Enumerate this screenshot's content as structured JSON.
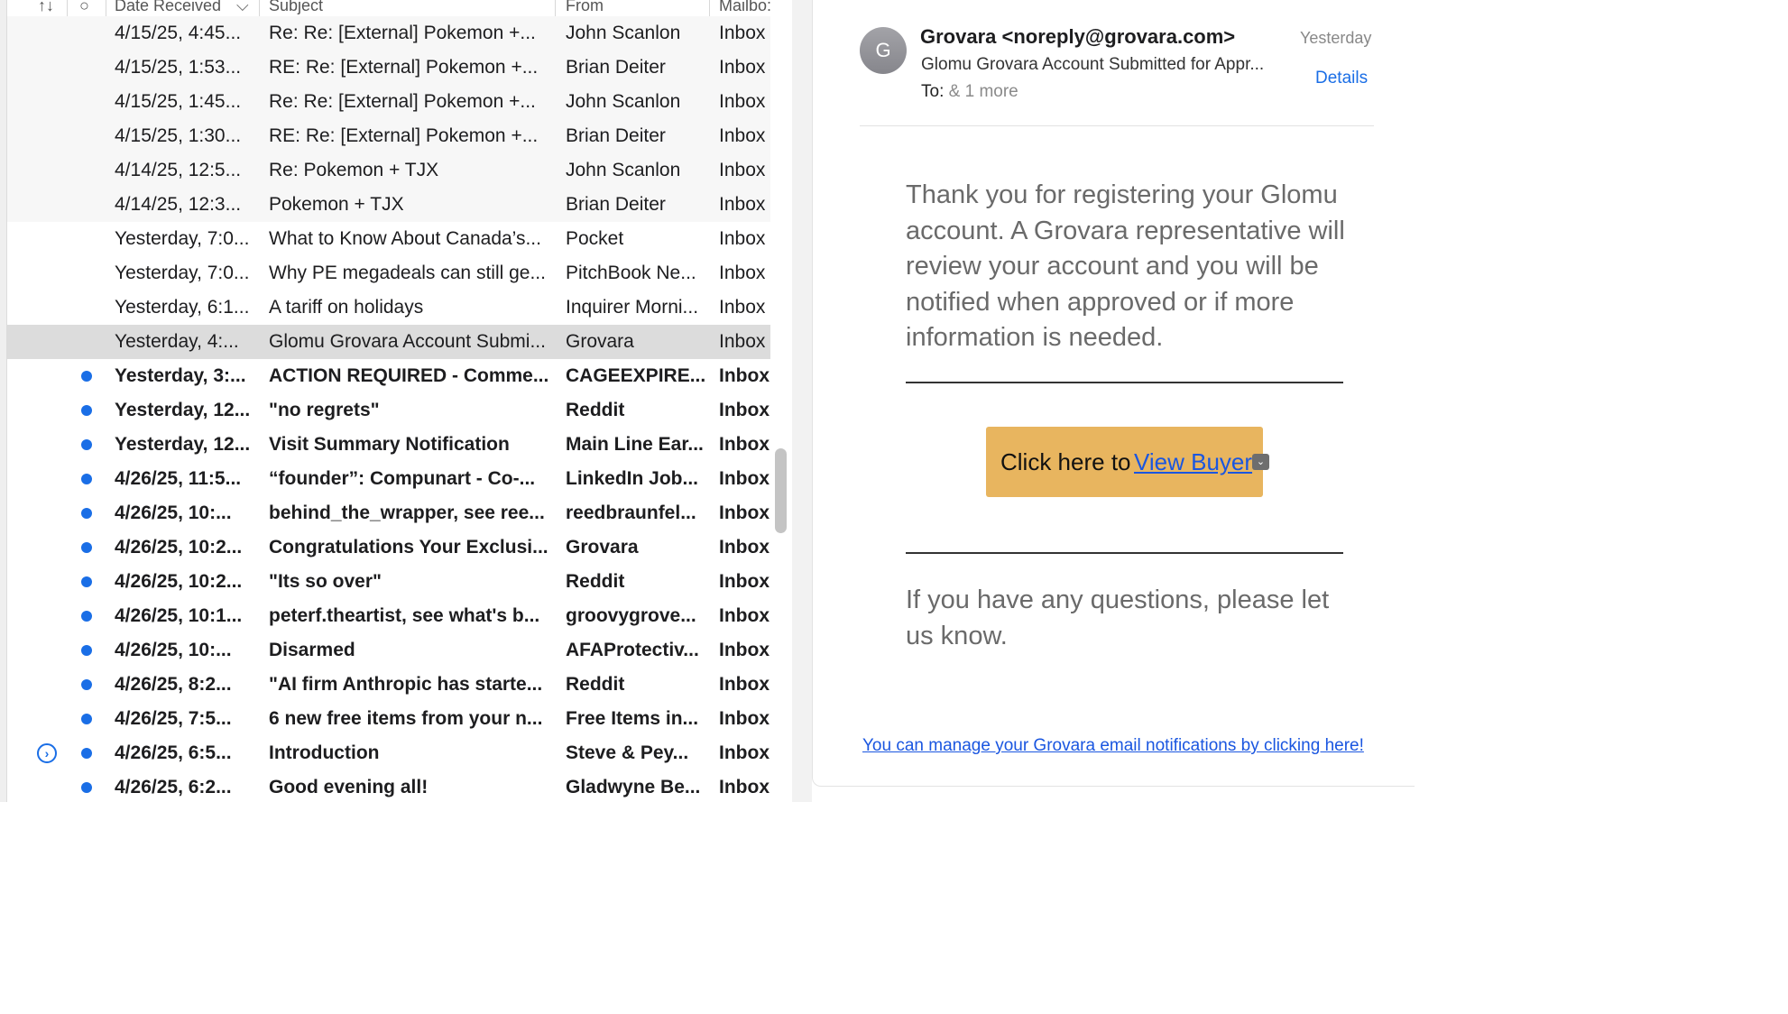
{
  "message_list": {
    "columns": {
      "sort": "↑↓",
      "status": "○",
      "date": "Date Received",
      "date_sort": "⌵",
      "subject": "Subject",
      "from": "From",
      "mailbox": "Mailbo:"
    },
    "rows": [
      {
        "date": "4/15/25, 4:45...",
        "subject": "Re: Re: [External] Pokemon +...",
        "from": "John Scanlon",
        "mailbox": "Inbox",
        "style": "thread",
        "unread": false
      },
      {
        "date": "4/15/25, 1:53...",
        "subject": "RE: Re: [External] Pokemon +...",
        "from": "Brian Deiter",
        "mailbox": "Inbox",
        "style": "thread",
        "unread": false
      },
      {
        "date": "4/15/25, 1:45...",
        "subject": "Re: Re: [External] Pokemon +...",
        "from": "John Scanlon",
        "mailbox": "Inbox",
        "style": "thread",
        "unread": false
      },
      {
        "date": "4/15/25, 1:30...",
        "subject": "RE: Re: [External] Pokemon +...",
        "from": "Brian Deiter",
        "mailbox": "Inbox",
        "style": "thread",
        "unread": false
      },
      {
        "date": "4/14/25, 12:5...",
        "subject": "Re: Pokemon + TJX",
        "from": "John Scanlon",
        "mailbox": "Inbox",
        "style": "thread",
        "unread": false
      },
      {
        "date": "4/14/25, 12:3...",
        "subject": "Pokemon + TJX",
        "from": "Brian Deiter",
        "mailbox": "Inbox",
        "style": "thread",
        "unread": false
      },
      {
        "date": "Yesterday, 7:0...",
        "subject": "What to Know About Canada’s...",
        "from": "Pocket",
        "mailbox": "Inbox",
        "style": "",
        "unread": false
      },
      {
        "date": "Yesterday, 7:0...",
        "subject": "Why PE megadeals can still ge...",
        "from": "PitchBook Ne...",
        "mailbox": "Inbox",
        "style": "",
        "unread": false
      },
      {
        "date": "Yesterday, 6:1...",
        "subject": "A tariff on holidays",
        "from": "Inquirer Morni...",
        "mailbox": "Inbox",
        "style": "",
        "unread": false
      },
      {
        "date": "Yesterday, 4:...",
        "subject": "Glomu Grovara Account Submi...",
        "from": "Grovara",
        "mailbox": "Inbox",
        "style": "selected",
        "unread": false
      },
      {
        "date": "Yesterday, 3:...",
        "subject": "ACTION REQUIRED - Comme...",
        "from": "CAGEEXPIRE...",
        "mailbox": "Inbox",
        "style": "",
        "unread": true
      },
      {
        "date": "Yesterday, 12...",
        "subject": "\"no regrets\"",
        "from": "Reddit",
        "mailbox": "Inbox",
        "style": "",
        "unread": true
      },
      {
        "date": "Yesterday, 12...",
        "subject": "Visit Summary Notification",
        "from": "Main Line Ear...",
        "mailbox": "Inbox",
        "style": "",
        "unread": true
      },
      {
        "date": "4/26/25, 11:5...",
        "subject": "“founder”: Compunart - Co-...",
        "from": "LinkedIn Job...",
        "mailbox": "Inbox",
        "style": "",
        "unread": true
      },
      {
        "date": "4/26/25, 10:...",
        "subject": "behind_the_wrapper, see ree...",
        "from": "reedbraunfel...",
        "mailbox": "Inbox",
        "style": "",
        "unread": true
      },
      {
        "date": "4/26/25, 10:2...",
        "subject": "Congratulations Your Exclusi...",
        "from": "Grovara",
        "mailbox": "Inbox",
        "style": "",
        "unread": true
      },
      {
        "date": "4/26/25, 10:2...",
        "subject": "\"Its so over\"",
        "from": "Reddit",
        "mailbox": "Inbox",
        "style": "",
        "unread": true
      },
      {
        "date": "4/26/25, 10:1...",
        "subject": "peterf.theartist, see what's b...",
        "from": "groovygrove...",
        "mailbox": "Inbox",
        "style": "",
        "unread": true
      },
      {
        "date": "4/26/25, 10:...",
        "subject": "Disarmed",
        "from": "AFAProtectiv...",
        "mailbox": "Inbox",
        "style": "",
        "unread": true
      },
      {
        "date": "4/26/25, 8:2...",
        "subject": "\"AI firm Anthropic has starte...",
        "from": "Reddit",
        "mailbox": "Inbox",
        "style": "",
        "unread": true
      },
      {
        "date": "4/26/25, 7:5...",
        "subject": "6 new free items from your n...",
        "from": "Free Items in...",
        "mailbox": "Inbox",
        "style": "",
        "unread": true
      },
      {
        "date": "4/26/25, 6:5...",
        "subject": "Introduction",
        "from": "Steve & Pey...",
        "mailbox": "Inbox",
        "style": "",
        "unread": true,
        "thread_button": "›"
      },
      {
        "date": "4/26/25, 6:2...",
        "subject": "Good evening all!",
        "from": "Gladwyne Be...",
        "mailbox": "Inbox",
        "style": "",
        "unread": true
      }
    ]
  },
  "reading_pane": {
    "avatar_initial": "G",
    "sender": "Grovara <noreply@grovara.com>",
    "received": "Yesterday",
    "subject": "Glomu Grovara Account Submitted for Appr...",
    "details_label": "Details",
    "to_label": "To:",
    "to_more": "& 1 more",
    "body": "Thank you for registering your Glomu account. A Grovara representative will review your account and you will be notified when approved or if more information is needed.",
    "cta_prefix": "Click here to",
    "cta_link": "View Buyer",
    "cta_dropdown_icon": "⌄",
    "questions": "If you have any questions, please let us know.",
    "manage_link": "You can manage your Grovara email notifications by clicking here!"
  },
  "colors": {
    "accent": "#1a6ee6",
    "link": "#1a56e0",
    "button": "#e8b55f",
    "selected_row": "#dcdcdc"
  }
}
